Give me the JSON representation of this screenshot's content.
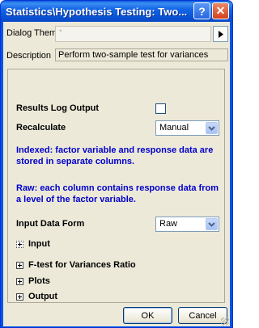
{
  "window": {
    "title": "Statistics\\Hypothesis Testing: Two..."
  },
  "titlebar": {
    "help_label": "?",
    "close_label": "✕"
  },
  "theme": {
    "label": "Dialog Theme",
    "value": "*"
  },
  "description": {
    "label": "Description",
    "value": "Perform two-sample test for variances"
  },
  "options": {
    "results_log_label": "Results Log Output",
    "results_log_checked": false,
    "recalculate_label": "Recalculate",
    "recalculate_value": "Manual",
    "info_indexed": "Indexed: factor variable and response data are stored in separate columns.",
    "info_raw": "Raw: each column contains response data from a level of the factor variable.",
    "input_form_label": "Input Data Form",
    "input_form_value": "Raw"
  },
  "tree": {
    "input": "Input",
    "ftest": "F-test for Variances Ratio",
    "plots": "Plots",
    "output": "Output"
  },
  "buttons": {
    "ok": "OK",
    "cancel": "Cancel"
  }
}
